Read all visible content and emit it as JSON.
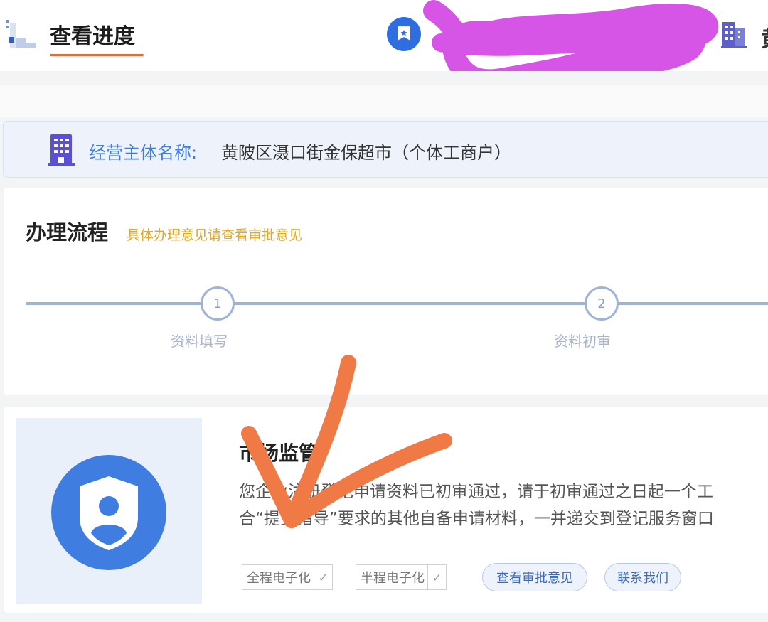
{
  "header": {
    "title": "查看进度",
    "clipped_text": "黄"
  },
  "entity": {
    "label": "经营主体名称:",
    "value": "黄陂区滠口街金保超市（个体工商户）"
  },
  "process": {
    "title": "办理流程",
    "subtitle": "具体办理意见请查看审批意见",
    "steps": [
      {
        "number": "1",
        "label": "资料填写"
      },
      {
        "number": "2",
        "label": "资料初审"
      }
    ]
  },
  "notice": {
    "title": "市场监管",
    "line1": "您企业注册登记申请资料已初审通过，请于初审通过之日起一个工",
    "line2": "合“提交指导”要求的其他自备申请材料，一并递交到登记服务窗口",
    "tags": [
      {
        "label": "全程电子化"
      },
      {
        "label": "半程电子化"
      }
    ],
    "view_opinion_button": "查看审批意见",
    "contact_button": "联系我们"
  },
  "colors": {
    "accent": "#3f7ee0",
    "tab_underline": "#e36a3a",
    "subtitle": "#e2a827"
  },
  "icons": {
    "logo": "building-blocks-icon",
    "badge": "certificate-icon",
    "building": "office-building-icon",
    "shield": "shield-user-icon"
  }
}
